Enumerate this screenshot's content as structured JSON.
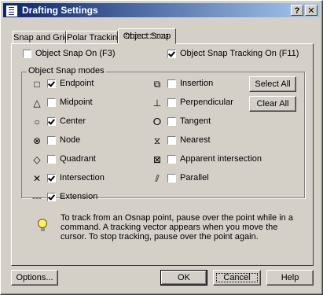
{
  "window": {
    "title": "Drafting Settings",
    "help_glyph": "?",
    "close_glyph": "✕"
  },
  "tabs": [
    "Snap and Grid",
    "Polar Tracking",
    "Object Snap"
  ],
  "osnap_on": {
    "label": "Object Snap On (F3)",
    "checked": false
  },
  "tracking_on": {
    "label": "Object Snap Tracking On (F11)",
    "checked": true
  },
  "group_title": "Object Snap modes",
  "modes_left": [
    {
      "symbol": "□",
      "label": "Endpoint",
      "checked": true
    },
    {
      "symbol": "△",
      "label": "Midpoint",
      "checked": false
    },
    {
      "symbol": "○",
      "label": "Center",
      "checked": true
    },
    {
      "symbol": "⊗",
      "label": "Node",
      "checked": false
    },
    {
      "symbol": "◇",
      "label": "Quadrant",
      "checked": false
    },
    {
      "symbol": "✕",
      "label": "Intersection",
      "checked": true
    },
    {
      "symbol": "---",
      "label": "Extension",
      "checked": true
    }
  ],
  "modes_right": [
    {
      "symbol": "⧉",
      "label": "Insertion",
      "checked": false
    },
    {
      "symbol": "⊥",
      "label": "Perpendicular",
      "checked": false
    },
    {
      "symbol": "ⵔ",
      "label": "Tangent",
      "checked": false
    },
    {
      "symbol": "⧖",
      "label": "Nearest",
      "checked": false
    },
    {
      "symbol": "⊠",
      "label": "Apparent intersection",
      "checked": false
    },
    {
      "symbol": "⫽",
      "label": "Parallel",
      "checked": false
    }
  ],
  "buttons": {
    "select_all": "Select All",
    "clear_all": "Clear All",
    "options": "Options...",
    "ok": "OK",
    "cancel": "Cancel",
    "help": "Help"
  },
  "help_text": "To track from an Osnap point, pause over the point while in a command. A tracking vector appears when you move the cursor. To stop tracking, pause over the point again."
}
